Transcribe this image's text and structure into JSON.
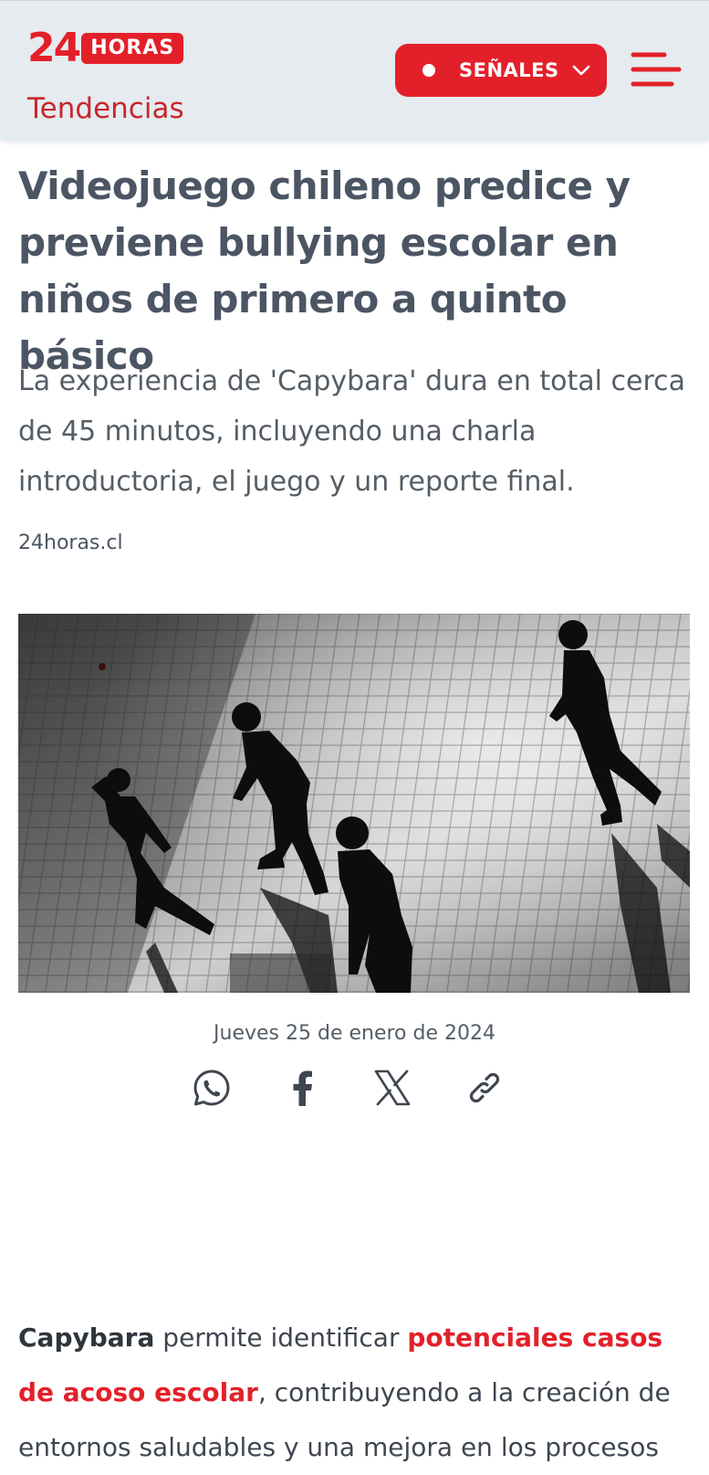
{
  "header": {
    "logo_number": "24",
    "logo_word": "HORAS",
    "section": "Tendencias",
    "signals_button": "SEÑALES",
    "icons": {
      "signals_dot": "live-dot-icon",
      "signals_chevron": "chevron-down-icon",
      "menu": "hamburger-menu-icon"
    }
  },
  "article": {
    "headline": "Videojuego chileno predice y previene bullying escolar en niños de primero a quinto básico",
    "lead": "La experiencia de 'Capybara' dura en total cerca de 45 minutos, incluyendo una charla introductoria, el juego y un reporte final.",
    "source": "24horas.cl",
    "image": "children-silhouettes-playing-photo",
    "date": "Jueves 25 de enero de 2024",
    "share": {
      "whatsapp": "whatsapp-icon",
      "facebook": "facebook-icon",
      "x": "x-icon",
      "link": "link-icon"
    },
    "body": {
      "strong_start": "Capybara",
      "text_1": " permite identificar ",
      "highlight": "potenciales casos de acoso escolar",
      "text_2": ", contribuyendo a la creación de entornos saludables y una mejora en los procesos"
    }
  },
  "colors": {
    "brand_red": "#e3202a",
    "header_bg": "#e5ebee",
    "text_gray": "#4b5563"
  }
}
